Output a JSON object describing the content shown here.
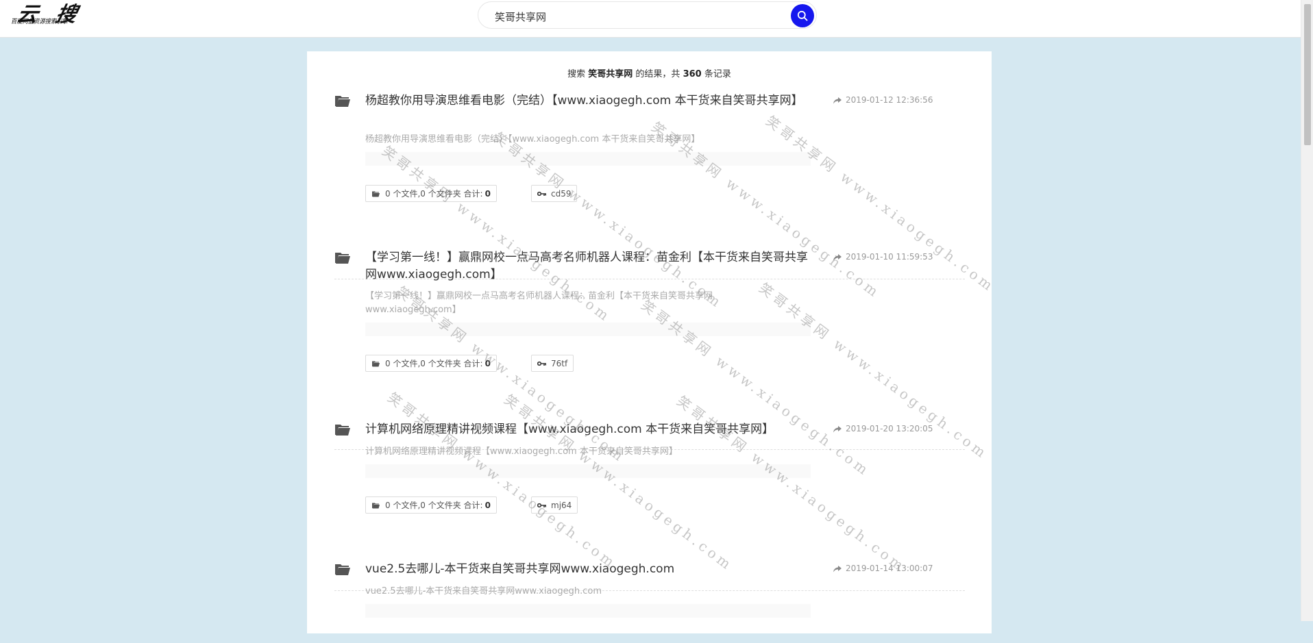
{
  "logo": {
    "main": "云 搜",
    "subtitle": "百度网盘资源搜索引擎"
  },
  "search": {
    "value": "笑哥共享网",
    "button_icon": "search-icon"
  },
  "summary": {
    "prefix": "搜索",
    "keyword": "笑哥共享网",
    "middle": "的结果，共",
    "count": "360",
    "suffix": "条记录"
  },
  "watermark_text": "笑哥共享网 www.xiaogegh.com",
  "results": [
    {
      "title": "杨超教你用导演思维看电影（完结）【www.xiaogegh.com 本干货来自笑哥共享网】",
      "date": "2019-01-12 12:36:56",
      "desc": "杨超教你用导演思维看电影（完结）【www.xiaogegh.com 本干货来自笑哥共享网】",
      "files": "0 个文件,0 个文件夹 合计:",
      "total": "0",
      "code": "cd59"
    },
    {
      "title": "【学习第一线！】赢鼎网校一点马高考名师机器人课程：苗金利【本干货来自笑哥共享网www.xiaogegh.com】",
      "date": "2019-01-10 11:59:53",
      "desc": "【学习第一线！】赢鼎网校一点马高考名师机器人课程：苗金利【本干货来自笑哥共享网www.xiaogegh.com】",
      "files": "0 个文件,0 个文件夹 合计:",
      "total": "0",
      "code": "76tf"
    },
    {
      "title": "计算机网络原理精讲视频课程【www.xiaogegh.com 本干货来自笑哥共享网】",
      "date": "2019-01-20 13:20:05",
      "desc": "计算机网络原理精讲视频课程【www.xiaogegh.com 本干货来自笑哥共享网】",
      "files": "0 个文件,0 个文件夹 合计:",
      "total": "0",
      "code": "mj64"
    },
    {
      "title": "vue2.5去哪儿-本干货来自笑哥共享网www.xiaogegh.com",
      "date": "2019-01-14 13:00:07",
      "desc": "vue2.5去哪儿-本干货来自笑哥共享网www.xiaogegh.com"
    }
  ]
}
